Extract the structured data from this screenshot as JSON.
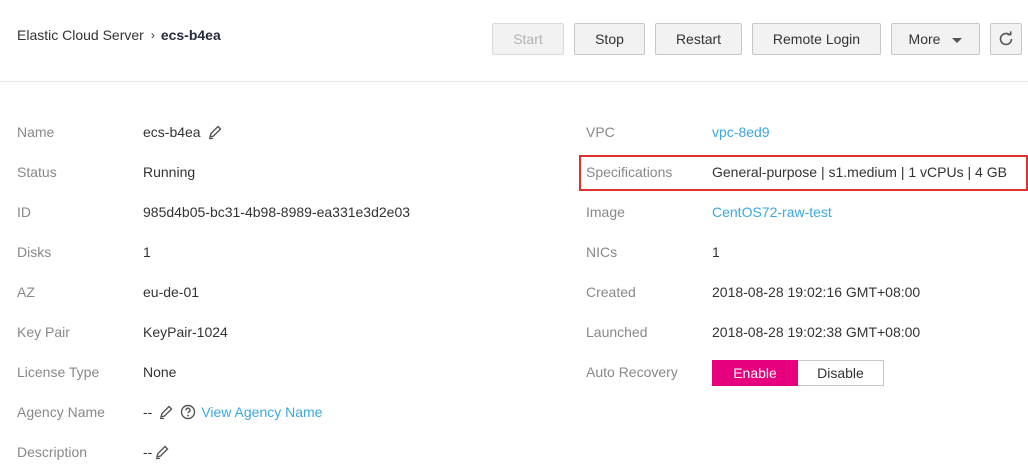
{
  "breadcrumb": {
    "parent": "Elastic Cloud Server",
    "separator": "›",
    "current": "ecs-b4ea"
  },
  "toolbar": {
    "start_label": "Start",
    "stop_label": "Stop",
    "restart_label": "Restart",
    "remote_login_label": "Remote Login",
    "more_label": "More",
    "refresh_icon": "refresh-icon"
  },
  "details_left": {
    "name": {
      "label": "Name",
      "value": "ecs-b4ea",
      "icon": "edit-pencil-icon"
    },
    "status": {
      "label": "Status",
      "value": "Running"
    },
    "id": {
      "label": "ID",
      "value": "985d4b05-bc31-4b98-8989-ea331e3d2e03"
    },
    "disks": {
      "label": "Disks",
      "value": "1"
    },
    "az": {
      "label": "AZ",
      "value": "eu-de-01"
    },
    "key_pair": {
      "label": "Key Pair",
      "value": "KeyPair-1024"
    },
    "license_type": {
      "label": "License Type",
      "value": "None"
    },
    "agency_name": {
      "label": "Agency Name",
      "value": "--",
      "link": "View Agency Name",
      "icon": "edit-pencil-icon",
      "help_icon": "help-circle-icon"
    },
    "description": {
      "label": "Description",
      "value": "--",
      "icon": "edit-pencil-icon"
    }
  },
  "details_right": {
    "vpc": {
      "label": "VPC",
      "value": "vpc-8ed9"
    },
    "specifications": {
      "label": "Specifications",
      "value": "General-purpose | s1.medium | 1 vCPUs | 4 GB"
    },
    "image": {
      "label": "Image",
      "value": "CentOS72-raw-test"
    },
    "nics": {
      "label": "NICs",
      "value": "1"
    },
    "created": {
      "label": "Created",
      "value": "2018-08-28 19:02:16 GMT+08:00"
    },
    "launched": {
      "label": "Launched",
      "value": "2018-08-28 19:02:38 GMT+08:00"
    },
    "auto_recovery": {
      "label": "Auto Recovery",
      "enable_label": "Enable",
      "disable_label": "Disable",
      "selected": "Enable"
    }
  },
  "colors": {
    "link": "#3ba8e0",
    "toggle_active": "#e6007e",
    "highlight_border": "#e0322d",
    "label": "#888888"
  }
}
